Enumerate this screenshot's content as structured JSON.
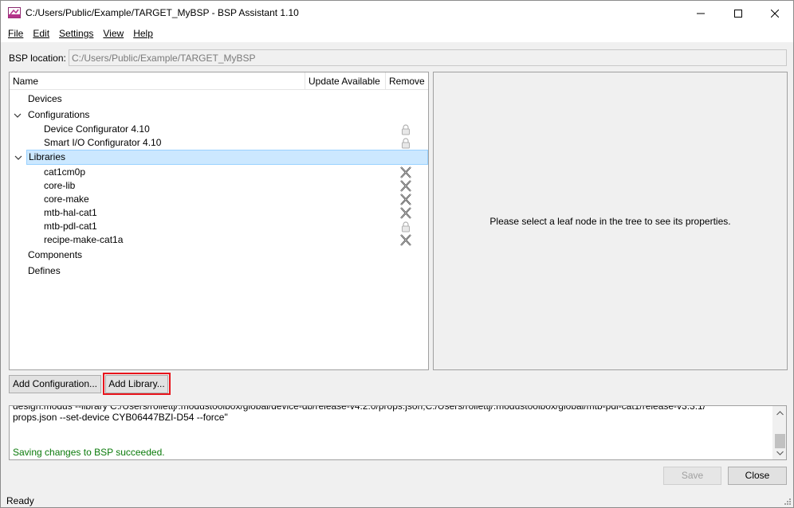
{
  "window": {
    "title": "C:/Users/Public/Example/TARGET_MyBSP - BSP Assistant 1.10",
    "icon": "bsp-assistant-icon"
  },
  "menu": [
    "File",
    "Edit",
    "Settings",
    "View",
    "Help"
  ],
  "bsp_location": {
    "label": "BSP location:",
    "value": "C:/Users/Public/Example/TARGET_MyBSP"
  },
  "tree": {
    "columns": [
      "Name",
      "Update Available",
      "Remove"
    ],
    "rows": [
      {
        "label": "Devices",
        "level": 0,
        "expanded": null,
        "remove": "none",
        "selected": false
      },
      {
        "label": "Configurations",
        "level": 0,
        "expanded": true,
        "remove": "none",
        "selected": false
      },
      {
        "label": "Device Configurator 4.10",
        "level": 1,
        "expanded": null,
        "remove": "lock",
        "selected": false
      },
      {
        "label": "Smart I/O Configurator 4.10",
        "level": 1,
        "expanded": null,
        "remove": "lock",
        "selected": false
      },
      {
        "label": "Libraries",
        "level": 0,
        "expanded": true,
        "remove": "none",
        "selected": true
      },
      {
        "label": "cat1cm0p",
        "level": 1,
        "expanded": null,
        "remove": "x",
        "selected": false
      },
      {
        "label": "core-lib",
        "level": 1,
        "expanded": null,
        "remove": "x",
        "selected": false
      },
      {
        "label": "core-make",
        "level": 1,
        "expanded": null,
        "remove": "x",
        "selected": false
      },
      {
        "label": "mtb-hal-cat1",
        "level": 1,
        "expanded": null,
        "remove": "x",
        "selected": false
      },
      {
        "label": "mtb-pdl-cat1",
        "level": 1,
        "expanded": null,
        "remove": "lock",
        "selected": false
      },
      {
        "label": "recipe-make-cat1a",
        "level": 1,
        "expanded": null,
        "remove": "x",
        "selected": false
      },
      {
        "label": "Components",
        "level": 0,
        "expanded": null,
        "remove": "none",
        "selected": false
      },
      {
        "label": "Defines",
        "level": 0,
        "expanded": null,
        "remove": "none",
        "selected": false
      }
    ]
  },
  "properties": {
    "message": "Please select a leaf node in the tree to see its properties."
  },
  "buttons": {
    "add_configuration": "Add Configuration...",
    "add_library": "Add Library...",
    "save": "Save",
    "close": "Close"
  },
  "log": {
    "cut_line": "design.modus --library C:/Users/rollettj/.modustoolbox/global/device-db/release-v4.2.0/props.json,C:/Users/rollettj/.modustoolbox/global/mtb-pdl-cat1/release-v3.3.1/",
    "line_1": "props.json --set-device CYB06447BZI-D54 --force\"",
    "success": "Saving changes to BSP succeeded."
  },
  "status": {
    "text": "Ready"
  },
  "colors": {
    "selection": "#cce8ff",
    "success_text": "#0a7a0a",
    "highlight": "#e8141c"
  }
}
